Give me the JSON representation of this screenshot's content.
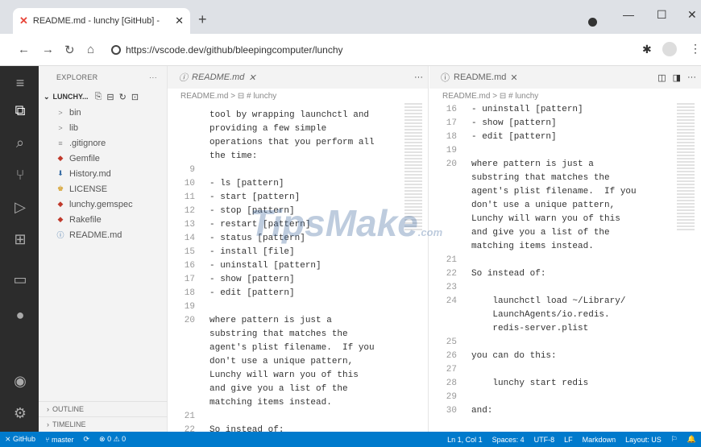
{
  "browser": {
    "tab_title": "README.md - lunchy [GitHub] -",
    "url": "https://vscode.dev/github/bleepingcomputer/lunchy"
  },
  "sidebar": {
    "header": "EXPLORER",
    "root": "LUNCHY...",
    "files": [
      {
        "name": "bin",
        "icon": ">",
        "color": "#888"
      },
      {
        "name": "lib",
        "icon": ">",
        "color": "#888"
      },
      {
        "name": ".gitignore",
        "icon": "≡",
        "color": "#888"
      },
      {
        "name": "Gemfile",
        "icon": "◆",
        "color": "#c0392b"
      },
      {
        "name": "History.md",
        "icon": "⬇",
        "color": "#3a6ea5"
      },
      {
        "name": "LICENSE",
        "icon": "♚",
        "color": "#d6a230"
      },
      {
        "name": "lunchy.gemspec",
        "icon": "◆",
        "color": "#c0392b"
      },
      {
        "name": "Rakefile",
        "icon": "◆",
        "color": "#c0392b"
      },
      {
        "name": "README.md",
        "icon": "ⓘ",
        "color": "#3a6ea5"
      }
    ],
    "outline": "OUTLINE",
    "timeline": "TIMELINE"
  },
  "left_editor": {
    "tab": "README.md",
    "breadcrumb": "README.md > ⊟ # lunchy",
    "lines": [
      {
        "n": "",
        "t": "tool by wrapping launchctl and"
      },
      {
        "n": "",
        "t": "providing a few simple"
      },
      {
        "n": "",
        "t": "operations that you perform all"
      },
      {
        "n": "",
        "t": "the time:"
      },
      {
        "n": "9",
        "t": ""
      },
      {
        "n": "10",
        "t": "- ls [pattern]"
      },
      {
        "n": "11",
        "t": "- start [pattern]"
      },
      {
        "n": "12",
        "t": "- stop [pattern]"
      },
      {
        "n": "13",
        "t": "- restart [pattern]"
      },
      {
        "n": "14",
        "t": "- status [pattern]"
      },
      {
        "n": "15",
        "t": "- install [file]"
      },
      {
        "n": "16",
        "t": "- uninstall [pattern]"
      },
      {
        "n": "17",
        "t": "- show [pattern]"
      },
      {
        "n": "18",
        "t": "- edit [pattern]"
      },
      {
        "n": "19",
        "t": ""
      },
      {
        "n": "20",
        "t": "where pattern is just a"
      },
      {
        "n": "",
        "t": "substring that matches the"
      },
      {
        "n": "",
        "t": "agent's plist filename.  If you"
      },
      {
        "n": "",
        "t": "don't use a unique pattern,"
      },
      {
        "n": "",
        "t": "Lunchy will warn you of this"
      },
      {
        "n": "",
        "t": "and give you a list of the"
      },
      {
        "n": "",
        "t": "matching items instead."
      },
      {
        "n": "21",
        "t": ""
      },
      {
        "n": "22",
        "t": "So instead of:"
      }
    ]
  },
  "right_editor": {
    "tab": "README.md",
    "breadcrumb": "README.md > ⊟ # lunchy",
    "lines": [
      {
        "n": "16",
        "t": "- uninstall [pattern]"
      },
      {
        "n": "17",
        "t": "- show [pattern]"
      },
      {
        "n": "18",
        "t": "- edit [pattern]"
      },
      {
        "n": "19",
        "t": ""
      },
      {
        "n": "20",
        "t": "where pattern is just a"
      },
      {
        "n": "",
        "t": "substring that matches the"
      },
      {
        "n": "",
        "t": "agent's plist filename.  If you"
      },
      {
        "n": "",
        "t": "don't use a unique pattern,"
      },
      {
        "n": "",
        "t": "Lunchy will warn you of this"
      },
      {
        "n": "",
        "t": "and give you a list of the"
      },
      {
        "n": "",
        "t": "matching items instead."
      },
      {
        "n": "21",
        "t": ""
      },
      {
        "n": "22",
        "t": "So instead of:"
      },
      {
        "n": "23",
        "t": ""
      },
      {
        "n": "24",
        "t": "    launchctl load ~/Library/"
      },
      {
        "n": "",
        "t": "    LaunchAgents/io.redis."
      },
      {
        "n": "",
        "t": "    redis-server.plist"
      },
      {
        "n": "25",
        "t": ""
      },
      {
        "n": "26",
        "t": "you can do this:"
      },
      {
        "n": "27",
        "t": ""
      },
      {
        "n": "28",
        "t": "    lunchy start redis"
      },
      {
        "n": "29",
        "t": ""
      },
      {
        "n": "30",
        "t": "and:"
      }
    ]
  },
  "status": {
    "branch": "master",
    "errors": "⊗ 0 ⚠ 0",
    "remote": "GitHub",
    "pos": "Ln 1, Col 1",
    "spaces": "Spaces: 4",
    "enc": "UTF-8",
    "eol": "LF",
    "lang": "Markdown",
    "layout": "Layout: US"
  },
  "watermark": "TipsMake"
}
